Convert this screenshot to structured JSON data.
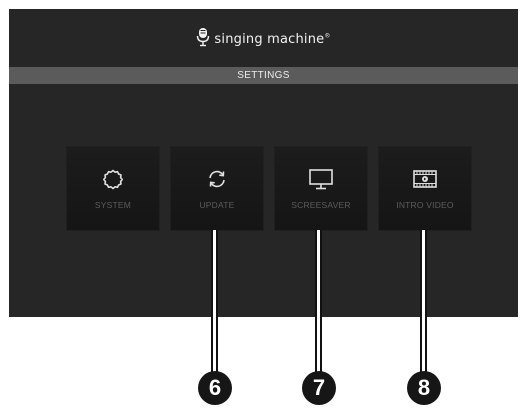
{
  "header": {
    "brand_name": "singing machine",
    "brand_mark": "®",
    "brand_icon": "microphone-icon"
  },
  "settings_bar": {
    "title": "SETTINGS"
  },
  "menu": [
    {
      "label": "SYSTEM",
      "icon": "gear-icon"
    },
    {
      "label": "UPDATE",
      "icon": "refresh-icon"
    },
    {
      "label": "SCREESAVER",
      "icon": "monitor-icon"
    },
    {
      "label": "INTRO VIDEO",
      "icon": "film-icon"
    }
  ],
  "callouts": [
    "6",
    "7",
    "8"
  ],
  "colors": {
    "screen_bg": "#262626",
    "bar_bg": "#5b5b5b",
    "tile_bg": "#1a1a1a",
    "tile_label": "#5c5c5c",
    "icon": "#e0e0e0",
    "badge_bg": "#161616"
  }
}
